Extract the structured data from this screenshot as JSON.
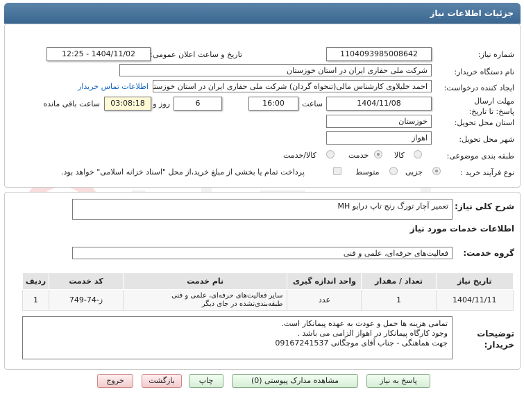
{
  "header": {
    "title": "جزئیات اطلاعات نیاز"
  },
  "form": {
    "need_number_label": "شماره نیاز:",
    "need_number": "1104093985008642",
    "announce_label": "تاریخ و ساعت اعلان عمومی:",
    "announce_value": "1404/11/02 - 12:25",
    "buyer_org_label": "نام دستگاه خریدار:",
    "buyer_org": "شرکت ملی حفاری ایران در استان خوزستان",
    "creator_label": "ایجاد کننده درخواست:",
    "creator": "احمد خلیلاوی کارشناس مالی(تنخواه گردان) شرکت ملی حفاری ایران در استان خوزستان",
    "contact_link": "اطلاعات تماس خریدار",
    "deadline_label": "مهلت ارسال پاسخ: تا تاریخ:",
    "deadline_date": "1404/11/08",
    "time_label": "ساعت",
    "deadline_time": "16:00",
    "days_value": "6",
    "days_label": "روز و",
    "remaining_time": "03:08:18",
    "remaining_label": "ساعت باقی مانده",
    "province_label": "استان محل تحویل:",
    "province": "خوزستان",
    "city_label": "شهر محل تحویل:",
    "city": "اهواز",
    "category_label": "طبقه بندی موضوعی:",
    "category_options": [
      "کالا",
      "خدمت",
      "کالا/خدمت"
    ],
    "purchase_type_label": "نوع فرآیند خرید :",
    "purchase_options": [
      "جزیی",
      "متوسط"
    ],
    "payment_note": "پرداخت تمام یا بخشی از مبلغ خرید،از محل \"اسناد خزانه اسلامی\" خواهد بود."
  },
  "summary": {
    "label": "شرح کلی نیاز:",
    "value": "تعمیر آچار تورگ رنج تاپ درایو MH"
  },
  "services": {
    "section_title": "اطلاعات خدمات مورد نیاز",
    "group_label": "گروه خدمت:",
    "group_value": "فعالیت‌های حرفه‌ای، علمی و فنی"
  },
  "table": {
    "headers": [
      "ردیف",
      "کد خدمت",
      "نام خدمت",
      "واحد اندازه گیری",
      "تعداد / مقدار",
      "تاریخ نیاز"
    ],
    "rows": [
      [
        "1",
        "ز-74-749",
        "سایر فعالیت‌های حرفه‌ای، علمی و فنی طبقه‌بندی‌نشده در جای دیگر",
        "عدد",
        "1",
        "1404/11/11"
      ]
    ]
  },
  "buyer_notes": {
    "label": "توضیحات خریدار:",
    "lines": [
      "تمامی هزینه ها حمل و عودت به عهده پیمانکار است.",
      "وجود کارگاه پیمانکار در اهواز الزامی می باشد .",
      "جهت هماهنگی - جناب آقای موچگانی 09167241537"
    ]
  },
  "buttons": {
    "reply": "پاسخ به نیاز",
    "attachments": "مشاهده مدارک پیوستی (0)",
    "print": "چاپ",
    "back": "بازگشت",
    "exit": "خروج"
  },
  "watermark_text": "AriaTender.net"
}
